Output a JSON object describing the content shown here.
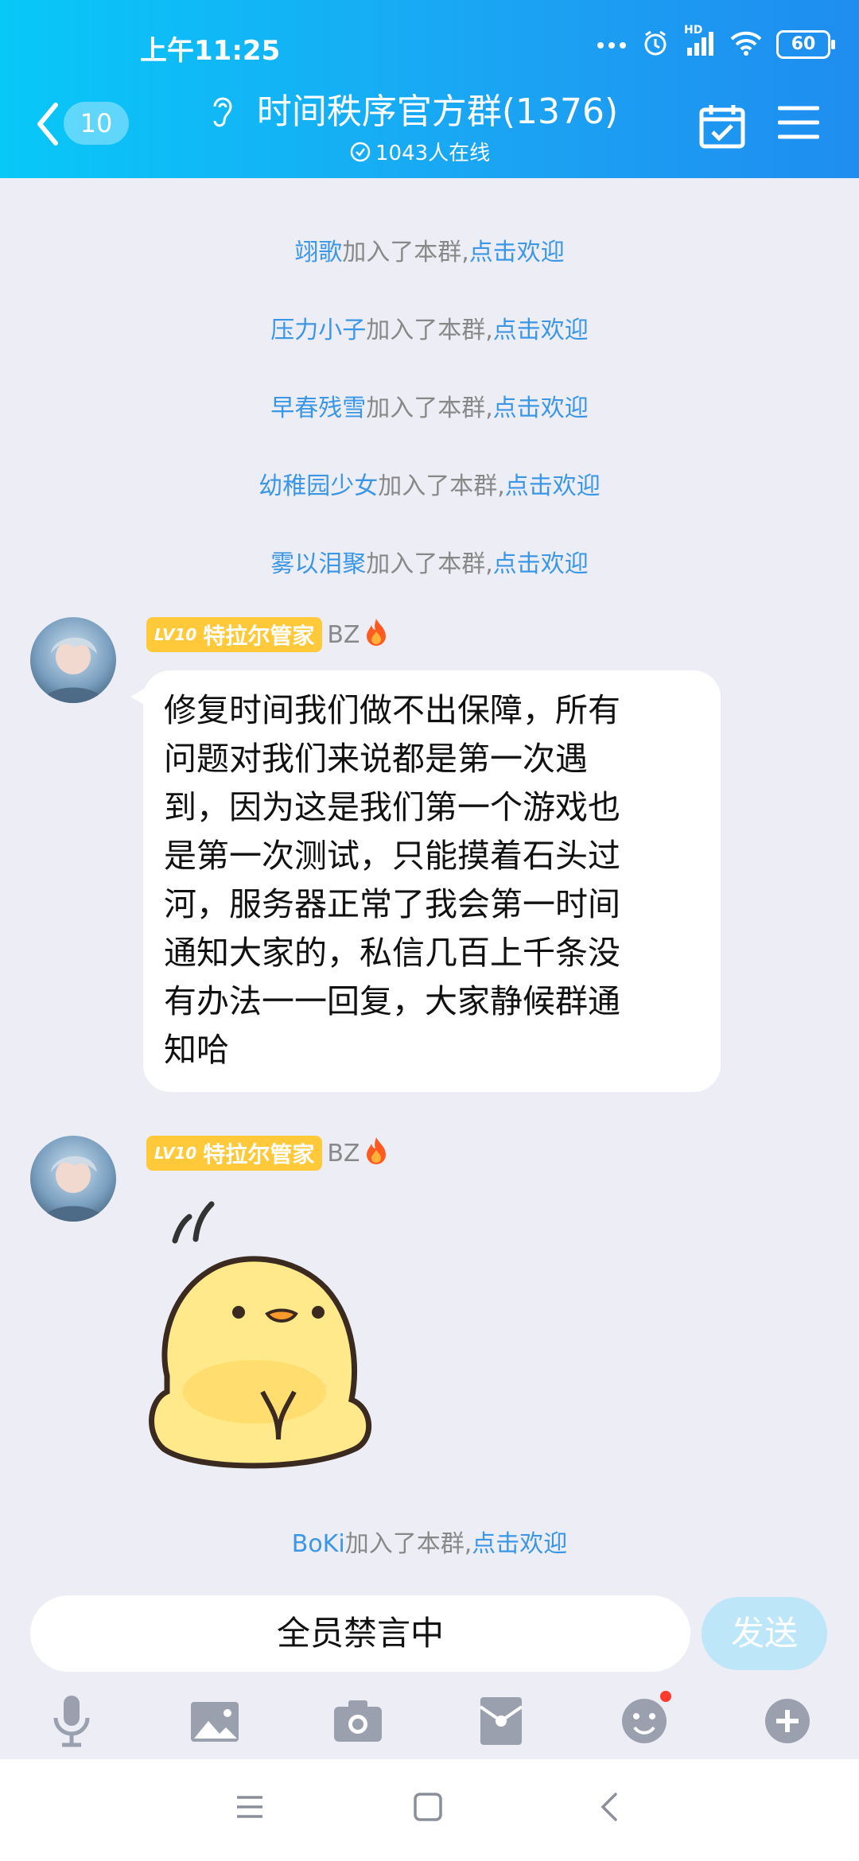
{
  "status": {
    "time": "上午11:25",
    "battery": "60",
    "network_label": "HD"
  },
  "header": {
    "unread_count": "10",
    "title": "时间秩序官方群(1376)",
    "online": "1043人在线"
  },
  "system_messages": [
    {
      "name": "翊歌",
      "text": "加入了本群,",
      "action": "点击欢迎"
    },
    {
      "name": "压力小子",
      "text": "加入了本群,",
      "action": "点击欢迎"
    },
    {
      "name": "早春残雪",
      "text": "加入了本群,",
      "action": "点击欢迎"
    },
    {
      "name": "幼稚园少女",
      "text": "加入了本群,",
      "action": "点击欢迎"
    },
    {
      "name": "雾以泪聚",
      "text": "加入了本群,",
      "action": "点击欢迎"
    },
    {
      "name": "BoKi",
      "text": "加入了本群,",
      "action": "点击欢迎"
    }
  ],
  "messages": [
    {
      "level": "LV10",
      "sender": "特拉尔管家",
      "role": "BZ",
      "text_lines": [
        "修复时间我们做不出保障，所有",
        "问题对我们来说都是第一次遇",
        "到，因为这是我们第一个游戏也",
        "是第一次测试，只能摸着石头过",
        "河，服务器正常了我会第一时间",
        "通知大家的，私信几百上千条没",
        "有办法一一回复，大家静候群通",
        "知哈"
      ]
    },
    {
      "level": "LV10",
      "sender": "特拉尔管家",
      "role": "BZ",
      "sticker": "yellow-chick-sticker"
    }
  ],
  "input": {
    "placeholder": "全员禁言中",
    "send_label": "发送"
  },
  "toolbar": [
    "microphone-icon",
    "image-icon",
    "camera-icon",
    "red-packet-icon",
    "emoji-icon",
    "plus-icon"
  ],
  "colors": {
    "header_start": "#08c8f8",
    "header_end": "#1f8df0",
    "link": "#3b97e6",
    "level_badge": "#ffc93a"
  }
}
